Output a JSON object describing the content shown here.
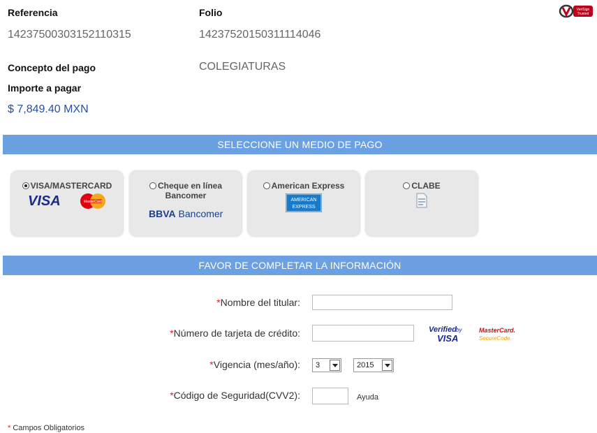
{
  "summary": {
    "referencia_label": "Referencia",
    "referencia_value": "14237500303152110315",
    "folio_label": "Folio",
    "folio_value": "14237520150311114046",
    "concepto_label": "Concepto del pago",
    "concepto_value": "COLEGIATURAS",
    "importe_label": "Importe a pagar",
    "importe_value": "$ 7,849.40 MXN"
  },
  "badge": {
    "text": "VeriSign\nTrusted"
  },
  "payment_header": "SELECCIONE UN MEDIO DE PAGO",
  "payment_methods": [
    {
      "label": "VISA/MASTERCARD",
      "selected": true,
      "logos": [
        "VISA",
        "MasterCard"
      ]
    },
    {
      "label": "Cheque en línea Bancomer",
      "selected": false,
      "logo": "BBVA Bancomer"
    },
    {
      "label": "American Express",
      "selected": false,
      "logo": "AMERICAN EXPRESS"
    },
    {
      "label": "CLABE",
      "selected": false,
      "logo": "document-icon"
    }
  ],
  "form_header": "FAVOR DE COMPLETAR LA INFORMACIÓN",
  "form": {
    "required_mark": "*",
    "name_label": "Nombre del titular:",
    "card_label": "Número de tarjeta de crédito:",
    "expiry_label": "Vigencia (mes/año):",
    "month_value": "3",
    "year_value": "2015",
    "cvv_label": "Código de Seguridad(CVV2):",
    "help_text": "Ayuda",
    "verified_visa": "Verified by VISA",
    "mastercard_securecode": "MasterCard. SecureCode."
  },
  "footer": {
    "required_note": "Campos Obligatorios"
  }
}
